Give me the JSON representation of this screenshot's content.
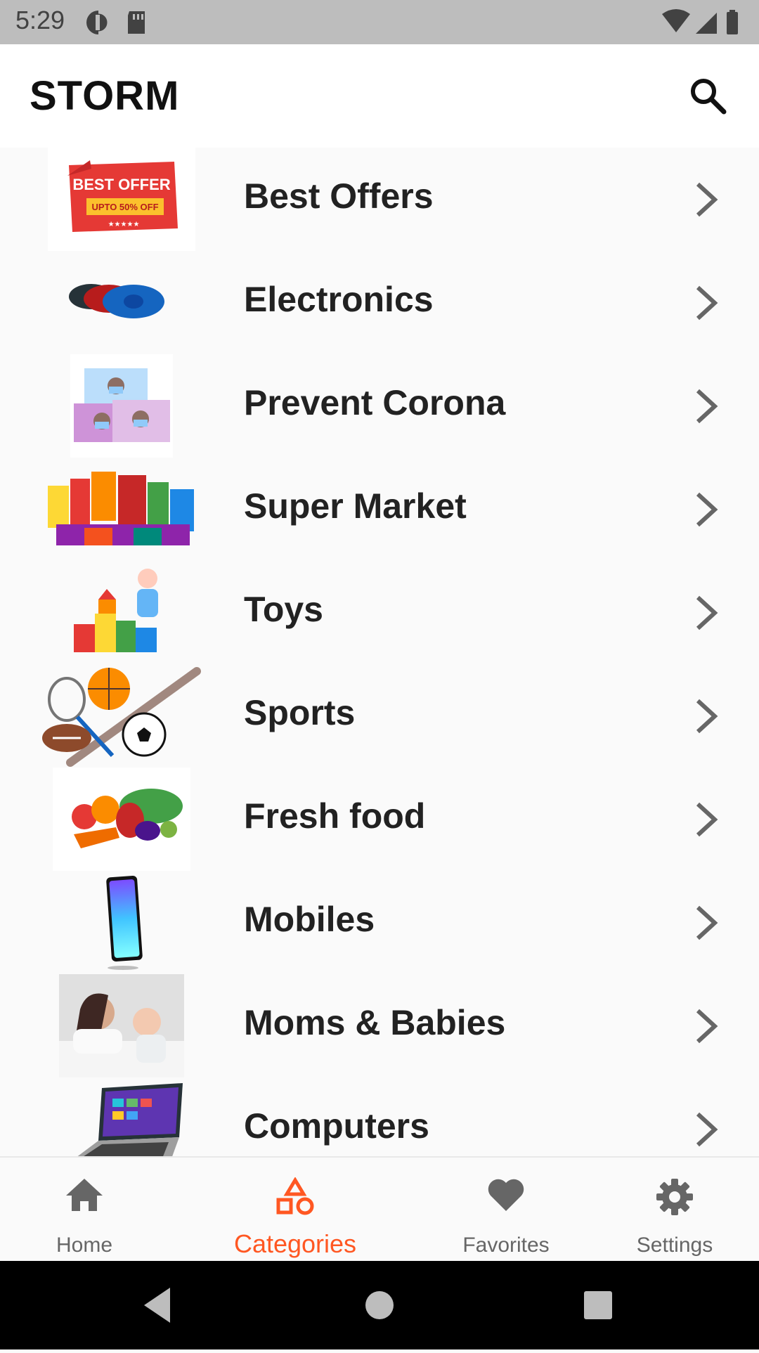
{
  "status_bar": {
    "time": "5:29",
    "left_icons": [
      "data-saver-icon",
      "sd-card-icon"
    ],
    "right_icons": [
      "wifi-icon",
      "signal-icon",
      "battery-icon"
    ]
  },
  "app_bar": {
    "title": "STORM",
    "search_icon": "search-icon"
  },
  "categories": [
    {
      "label": "Best Offers",
      "thumb": "best-offer-image"
    },
    {
      "label": "Electronics",
      "thumb": "speakers-image"
    },
    {
      "label": "Prevent Corona",
      "thumb": "face-masks-image"
    },
    {
      "label": "Super Market",
      "thumb": "groceries-image"
    },
    {
      "label": "Toys",
      "thumb": "toy-blocks-image"
    },
    {
      "label": "Sports",
      "thumb": "sports-balls-image"
    },
    {
      "label": "Fresh food",
      "thumb": "vegetables-image"
    },
    {
      "label": "Mobiles",
      "thumb": "smartphone-image"
    },
    {
      "label": "Moms & Babies",
      "thumb": "mom-baby-image"
    },
    {
      "label": "Computers",
      "thumb": "laptop-image"
    }
  ],
  "thumb_text": {
    "best_offer": "BEST OFFER",
    "best_offer_sub": "UPTO 50% OFF"
  },
  "bottom_nav": [
    {
      "label": "Home",
      "icon": "home-icon",
      "active": false
    },
    {
      "label": "Categories",
      "icon": "categories-icon",
      "active": true
    },
    {
      "label": "Favorites",
      "icon": "heart-icon",
      "active": false
    },
    {
      "label": "Settings",
      "icon": "gear-icon",
      "active": false
    }
  ],
  "colors": {
    "accent": "#ff5722",
    "status_bar": "#bdbdbd",
    "nav_inactive": "#666666"
  }
}
